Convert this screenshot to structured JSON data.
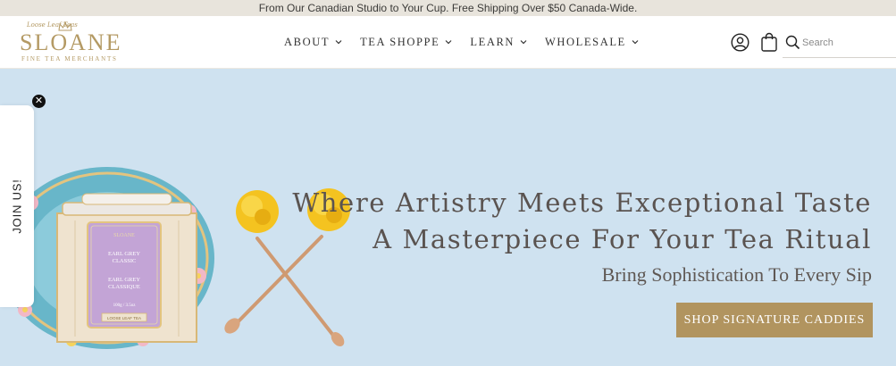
{
  "announcement": {
    "text": "From Our Canadian Studio to Your Cup. Free Shipping Over $50 Canada-Wide."
  },
  "logo": {
    "script": "Loose Leaf    Teas",
    "wordmark": "SLOANE",
    "tagline": "FINE TEA MERCHANTS"
  },
  "nav": {
    "items": [
      {
        "label": "ABOUT"
      },
      {
        "label": "TEA SHOPPE"
      },
      {
        "label": "LEARN"
      },
      {
        "label": "WHOLESALE"
      }
    ]
  },
  "header_icons": {
    "account": "user-circle-icon",
    "cart": "shopping-bag-icon",
    "search": "search-icon"
  },
  "search": {
    "placeholder": "Search",
    "value": ""
  },
  "hero": {
    "headline_line1": "Where Artistry Meets Exceptional Taste",
    "headline_line2": "A Masterpiece For Your Tea Ritual",
    "subheadline": "Bring Sophistication To Every Sip",
    "cta_label": "SHOP SIGNATURE CADDIES",
    "tin": {
      "line1": "EARL GREY",
      "line2": "CLASSIC",
      "line3": "EARL GREY",
      "line4": "CLASSIQUE",
      "weight": "100g / 3.5oz",
      "badge": "LOOSE LEAF TEA"
    }
  },
  "popup": {
    "label": "JOIN US!",
    "close": "✕"
  },
  "colors": {
    "accent": "#b1945f",
    "hero_bg": "#cfe2f0",
    "announcement_bg": "#e8e4dc",
    "text": "#5a5350"
  }
}
